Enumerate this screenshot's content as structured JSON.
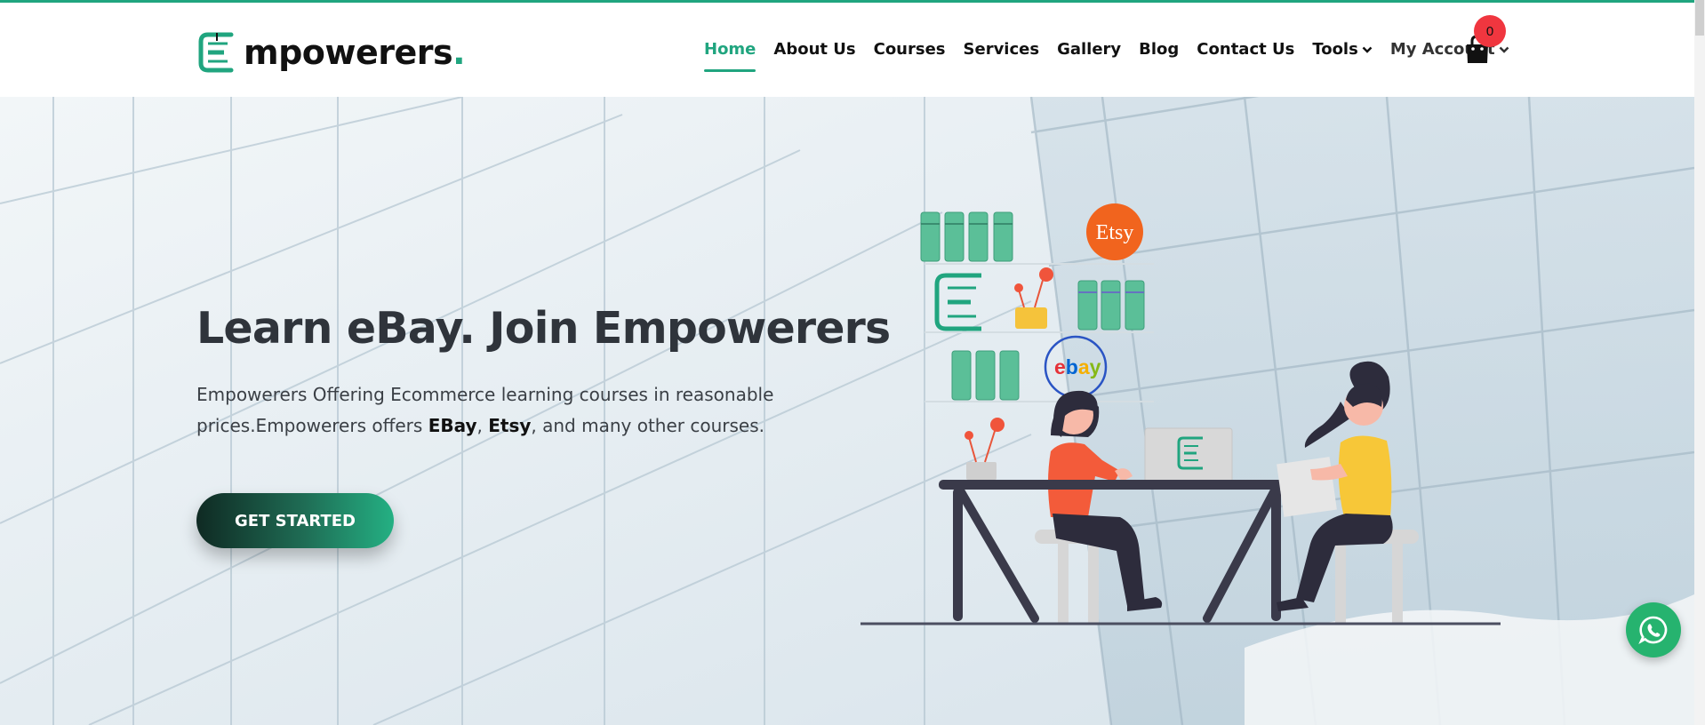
{
  "brand": {
    "name": "mpowerers",
    "dot": ".",
    "accent": "#20a57f"
  },
  "nav": {
    "items": [
      {
        "label": "Home",
        "active": true
      },
      {
        "label": "About Us"
      },
      {
        "label": "Courses"
      },
      {
        "label": "Services"
      },
      {
        "label": "Gallery"
      },
      {
        "label": "Blog"
      },
      {
        "label": "Contact Us"
      },
      {
        "label": "Tools",
        "dropdown": true
      },
      {
        "label": "My Account",
        "dropdown": true
      }
    ],
    "cart_count": "0"
  },
  "hero": {
    "title": "Learn eBay. Join Empowerers",
    "text_part1": "Empowerers Offering Ecommerce learning courses in reasonable prices.Empowerers offers ",
    "bold1": "EBay",
    "sep": ", ",
    "bold2": "Etsy",
    "text_part2": ", and many other courses.",
    "cta_label": "GET STARTED",
    "illustration_labels": {
      "etsy": "Etsy",
      "ebay_e": "e",
      "ebay_b": "b",
      "ebay_a": "a",
      "ebay_y": "y"
    }
  },
  "icons": {
    "cart": "shopping-bag-icon",
    "whatsapp": "whatsapp-icon",
    "dropdown": "chevron-down-icon"
  },
  "colors": {
    "accent": "#20a57f",
    "badge": "#f0363f",
    "whatsapp": "#26b36f",
    "etsy": "#f1641e"
  }
}
